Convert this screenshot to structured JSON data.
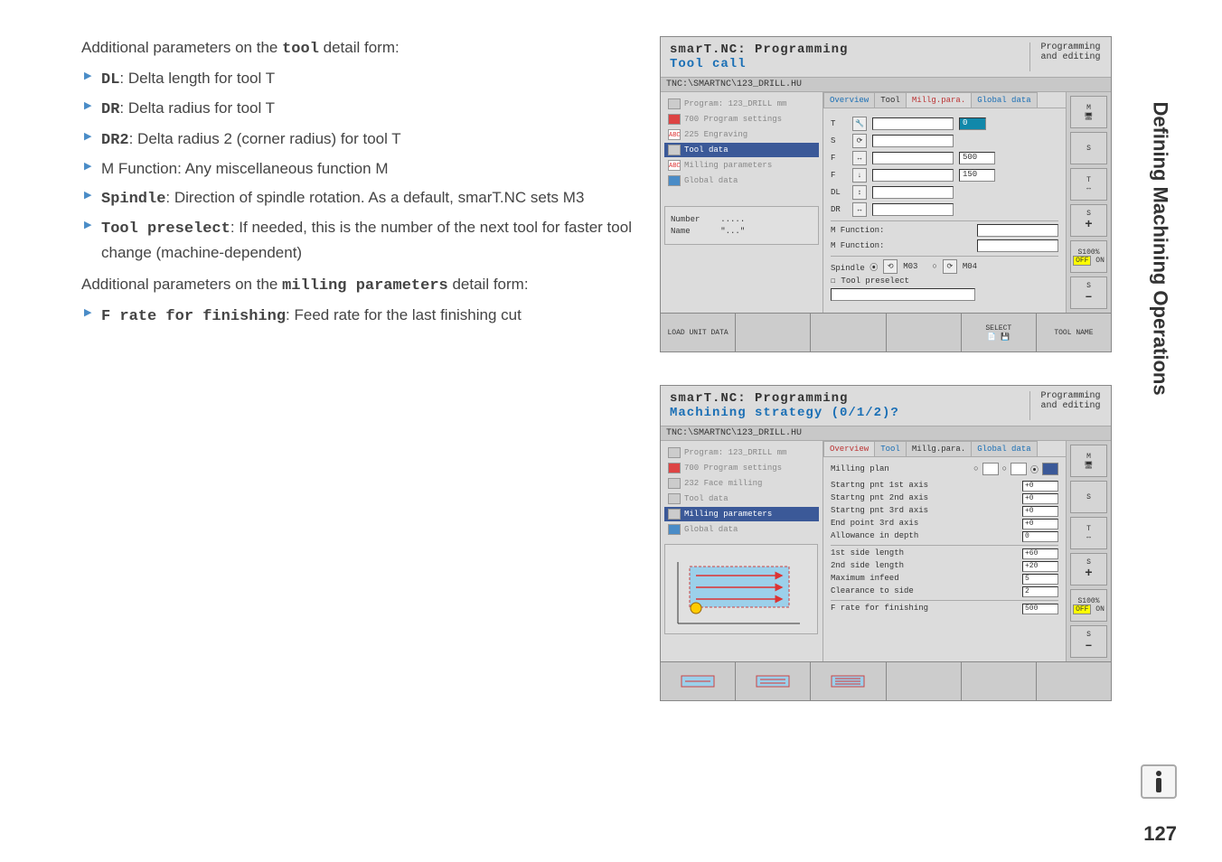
{
  "page": {
    "number": "127",
    "side_tab": "Defining Machining Operations"
  },
  "text": {
    "intro1": "Additional parameters on the ",
    "intro1_bold": "tool",
    "intro1_tail": " detail form:",
    "dl": "DL",
    "dl_desc": ": Delta length for tool T",
    "dr": "DR",
    "dr_desc": ": Delta radius for tool T",
    "dr2": "DR2",
    "dr2_desc": ": Delta radius 2 (corner radius) for tool T",
    "mfunc": "M Function: Any miscellaneous function M",
    "spindle": "Spindle",
    "spindle_desc": ": Direction of spindle rotation. As a default, smarT.NC sets M3",
    "toolpre": "Tool preselect",
    "toolpre_desc": ": If needed, this is the number of the next tool for faster tool change (machine-dependent)",
    "intro2": "Additional parameters on the ",
    "intro2_bold": "milling parameters",
    "intro2_tail": " detail form:",
    "frate": "F rate for finishing",
    "frate_desc": ": Feed rate for the last finishing cut"
  },
  "shot1": {
    "title": "smarT.NC: Programming",
    "subtitle": "Tool call",
    "mode": "Programming and editing",
    "file": "TNC:\\SMARTNC\\123_DRILL.HU",
    "tree": {
      "a": "Program: 123_DRILL mm",
      "b": "700 Program settings",
      "c": "225 Engraving",
      "d": "Tool data",
      "e": "Milling parameters",
      "f": "Global data"
    },
    "tabs": {
      "ov": "Overview",
      "tool": "Tool",
      "mp": "Millg.para.",
      "gd": "Global data"
    },
    "fields": {
      "t": "T",
      "s": "S",
      "f1": "F",
      "f2": "F",
      "dl": "DL",
      "dr": "DR",
      "val0": "0",
      "v500": "500",
      "v150": "150",
      "mf1": "M Function:",
      "mf2": "M Function:",
      "sp": "Spindle ⦿",
      "m03": "M03",
      "m04": "M04",
      "tp": "Tool preselect"
    },
    "side": {
      "m": "M",
      "s": "S",
      "t": "T",
      "plus": "+",
      "s100": "S100%",
      "off": "OFF",
      "on": "ON",
      "minus": "–"
    },
    "numname": {
      "num": "Number",
      "dots": ".....",
      "name": "Name",
      "quotes": "\"...\""
    },
    "sk": {
      "load": "LOAD UNIT DATA",
      "select": "SELECT",
      "toolname": "TOOL NAME"
    }
  },
  "shot2": {
    "title": "smarT.NC: Programming",
    "subtitle": "Machining strategy (0/1/2)?",
    "mode": "Programming and editing",
    "file": "TNC:\\SMARTNC\\123_DRILL.HU",
    "tree": {
      "a": "Program: 123_DRILL mm",
      "b": "700 Program settings",
      "c": "232 Face milling",
      "d": "Tool data",
      "e": "Milling parameters",
      "f": "Global data"
    },
    "tabs": {
      "ov": "Overview",
      "tool": "Tool",
      "mp": "Millg.para.",
      "gd": "Global data"
    },
    "millplan": "Milling plan",
    "params": {
      "p1": "Startng pnt 1st axis",
      "v1": "+0",
      "p2": "Startng pnt 2nd axis",
      "v2": "+0",
      "p3": "Startng pnt 3rd axis",
      "v3": "+0",
      "p4": "End point 3rd axis",
      "v4": "+0",
      "p5": "Allowance in depth",
      "v5": "0",
      "p6": "1st side length",
      "v6": "+60",
      "p7": "2nd side length",
      "v7": "+20",
      "p8": "Maximum infeed",
      "v8": "5",
      "p9": "Clearance to side",
      "v9": "2",
      "p10": "F rate for finishing",
      "v10": "500"
    },
    "side": {
      "m": "M",
      "s": "S",
      "t": "T",
      "plus": "+",
      "s100": "S100%",
      "off": "OFF",
      "on": "ON",
      "minus": "–"
    }
  }
}
